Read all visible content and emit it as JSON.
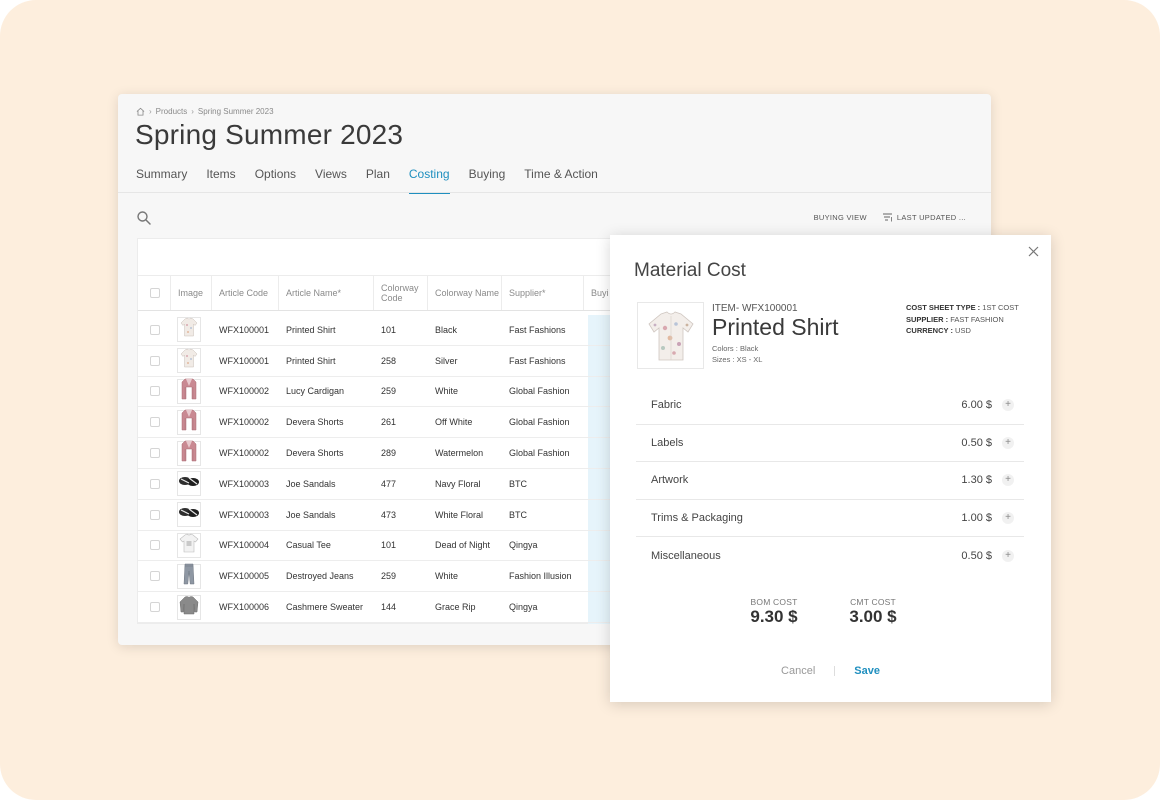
{
  "breadcrumb": [
    "Products",
    "Spring Summer 2023"
  ],
  "page_title": "Spring Summer 2023",
  "tabs": [
    "Summary",
    "Items",
    "Options",
    "Views",
    "Plan",
    "Costing",
    "Buying",
    "Time & Action"
  ],
  "active_tab": "Costing",
  "toolbar": {
    "buying_view": "BUYING VIEW",
    "last_updated": "LAST UPDATED ..."
  },
  "table": {
    "headers": [
      "Image",
      "Article Code",
      "Article Name*",
      "Colorway Code",
      "Colorway Name",
      "Supplier*",
      "Buyi"
    ],
    "rows": [
      {
        "code": "WFX100001",
        "name": "Printed Shirt",
        "cw_code": "101",
        "cw_name": "Black",
        "supplier": "Fast Fashions",
        "thumb": "shirt-icon"
      },
      {
        "code": "WFX100001",
        "name": "Printed Shirt",
        "cw_code": "258",
        "cw_name": "Silver",
        "supplier": "Fast Fashions",
        "thumb": "shirt-icon"
      },
      {
        "code": "WFX100002",
        "name": "Lucy Cardigan",
        "cw_code": "259",
        "cw_name": "White",
        "supplier": "Global Fashion",
        "thumb": "cardigan-icon"
      },
      {
        "code": "WFX100002",
        "name": "Devera Shorts",
        "cw_code": "261",
        "cw_name": "Off White",
        "supplier": "Global Fashion",
        "thumb": "cardigan-icon"
      },
      {
        "code": "WFX100002",
        "name": "Devera Shorts",
        "cw_code": "289",
        "cw_name": "Watermelon",
        "supplier": "Global Fashion",
        "thumb": "cardigan-icon"
      },
      {
        "code": "WFX100003",
        "name": "Joe Sandals",
        "cw_code": "477",
        "cw_name": "Navy Floral",
        "supplier": "BTC",
        "thumb": "sandals-icon"
      },
      {
        "code": "WFX100003",
        "name": "Joe Sandals",
        "cw_code": "473",
        "cw_name": "White Floral",
        "supplier": "BTC",
        "thumb": "sandals-icon"
      },
      {
        "code": "WFX100004",
        "name": "Casual Tee",
        "cw_code": "101",
        "cw_name": "Dead of Night",
        "supplier": "Qingya",
        "thumb": "tee-icon"
      },
      {
        "code": "WFX100005",
        "name": "Destroyed Jeans",
        "cw_code": "259",
        "cw_name": "White",
        "supplier": "Fashion Illusion",
        "thumb": "jeans-icon"
      },
      {
        "code": "WFX100006",
        "name": "Cashmere Sweater",
        "cw_code": "144",
        "cw_name": "Grace Rip",
        "supplier": "Qingya",
        "thumb": "sweater-icon"
      }
    ]
  },
  "modal": {
    "title": "Material Cost",
    "item_code": "ITEM- WFX100001",
    "product_name": "Printed Shirt",
    "colors_label": "Colors :",
    "colors_value": "Black",
    "sizes_label": "Sizes :",
    "sizes_value": "XS - XL",
    "cost_sheet_type_label": "COST SHEET TYPE :",
    "cost_sheet_type_value": "1ST COST",
    "supplier_label": "SUPPLIER :",
    "supplier_value": "FAST FASHION",
    "currency_label": "CURRENCY :",
    "currency_value": "USD",
    "costs": [
      {
        "label": "Fabric",
        "value": "6.00 $"
      },
      {
        "label": "Labels",
        "value": "0.50 $"
      },
      {
        "label": "Artwork",
        "value": "1.30 $"
      },
      {
        "label": "Trims & Packaging",
        "value": "1.00 $"
      },
      {
        "label": "Miscellaneous",
        "value": "0.50 $"
      }
    ],
    "bom_label": "BOM COST",
    "bom_value": "9.30 $",
    "cmt_label": "CMT COST",
    "cmt_value": "3.00 $",
    "cancel_label": "Cancel",
    "save_label": "Save"
  },
  "colors": {
    "accent": "#1f8fbf",
    "background": "#fdeedd",
    "highlight_column": "#e6f4fb"
  }
}
